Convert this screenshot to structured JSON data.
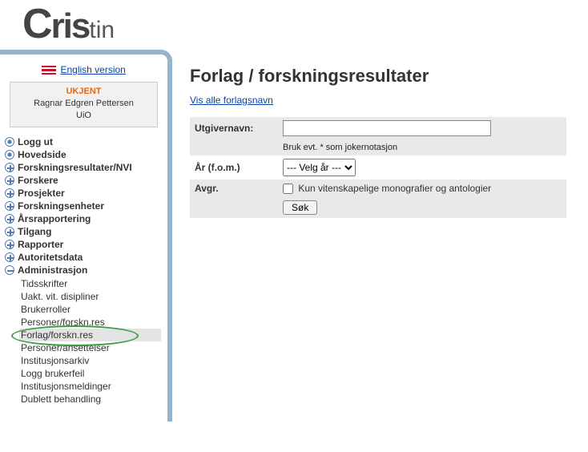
{
  "logo": {
    "c": "C",
    "ris": "ris",
    "tin": "tin"
  },
  "lang_link": "English version",
  "user": {
    "status": "UKJENT",
    "name": "Ragnar Edgren Pettersen",
    "org": "UiO"
  },
  "nav": [
    {
      "label": "Logg ut",
      "icon": "dot"
    },
    {
      "label": "Hovedside",
      "icon": "dot"
    },
    {
      "label": "Forskningsresultater/NVI",
      "icon": "plus"
    },
    {
      "label": "Forskere",
      "icon": "plus"
    },
    {
      "label": "Prosjekter",
      "icon": "plus"
    },
    {
      "label": "Forskningsenheter",
      "icon": "plus"
    },
    {
      "label": "Årsrapportering",
      "icon": "plus"
    },
    {
      "label": "Tilgang",
      "icon": "plus"
    },
    {
      "label": "Rapporter",
      "icon": "plus"
    },
    {
      "label": "Autoritetsdata",
      "icon": "plus"
    },
    {
      "label": "Administrasjon",
      "icon": "minus"
    }
  ],
  "subnav": [
    {
      "label": "Tidsskrifter"
    },
    {
      "label": "Uakt. vit. disipliner"
    },
    {
      "label": "Brukerroller"
    },
    {
      "label": "Personer/forskn.res"
    },
    {
      "label": "Forlag/forskn.res",
      "selected": true
    },
    {
      "label": "Personer/ansettelser"
    },
    {
      "label": "Institusjonsarkiv"
    },
    {
      "label": "Logg brukerfeil"
    },
    {
      "label": "Institusjonsmeldinger"
    },
    {
      "label": "Dublett behandling"
    }
  ],
  "page": {
    "title": "Forlag / forskningsresultater",
    "show_all_link": "Vis alle forlagsnavn",
    "form": {
      "publisher_label": "Utgivernavn:",
      "publisher_value": "",
      "hint": "Bruk evt. * som jokernotasjon",
      "year_label": "År (f.o.m.)",
      "year_placeholder": "--- Velg år ---",
      "limit_label": "Avgr.",
      "checkbox_label": "Kun vitenskapelige monografier og antologier",
      "submit": "Søk"
    }
  }
}
